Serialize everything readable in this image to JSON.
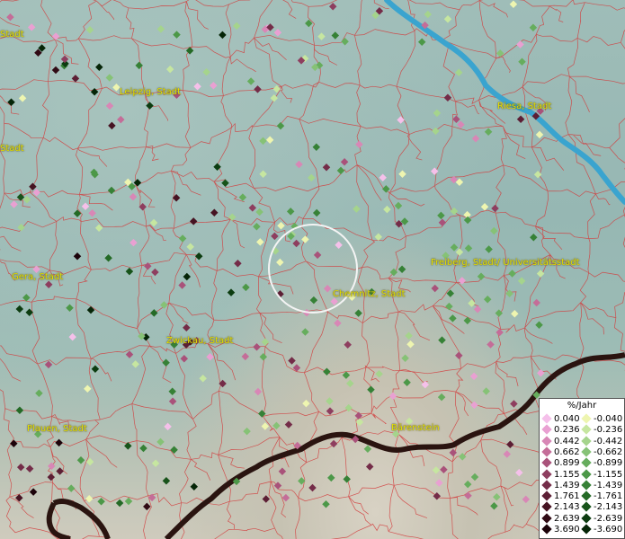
{
  "map": {
    "colors": {
      "boundary": "#d23c3c",
      "river": "#3aa4cf",
      "border": "#2a1410",
      "label": "#e6e000"
    },
    "cities": [
      {
        "name": "Stadt",
        "id": "city-stadt-top"
      },
      {
        "name": "Leipzig, Stadt",
        "id": "city-leipzig"
      },
      {
        "name": "Riesa, Stadt",
        "id": "city-riesa"
      },
      {
        "name": "Stadt",
        "id": "city-stadt-left"
      },
      {
        "name": "Gera, Stadt",
        "id": "city-gera"
      },
      {
        "name": "Freiberg, Stadt/ Universitätsstadt",
        "id": "city-freiberg"
      },
      {
        "name": "Chemnitz, Stadt",
        "id": "city-chemnitz"
      },
      {
        "name": "Zwickau, Stadt",
        "id": "city-zwickau"
      },
      {
        "name": "Plauen, Stadt",
        "id": "city-plauen"
      },
      {
        "name": "Bärenstein",
        "id": "city-baerenstein"
      }
    ]
  },
  "legend": {
    "title": "%/Jahr",
    "positive": [
      {
        "label": "0.040",
        "color": "#f5c0ea"
      },
      {
        "label": "0.236",
        "color": "#e9a0d2"
      },
      {
        "label": "0.442",
        "color": "#d887b6"
      },
      {
        "label": "0.662",
        "color": "#c46d98"
      },
      {
        "label": "0.899",
        "color": "#a9527a"
      },
      {
        "label": "1.155",
        "color": "#8e3e5f"
      },
      {
        "label": "1.439",
        "color": "#742c48"
      },
      {
        "label": "1.761",
        "color": "#5c1e34"
      },
      {
        "label": "2.143",
        "color": "#461322"
      },
      {
        "label": "2.639",
        "color": "#300a14"
      },
      {
        "label": "3.690",
        "color": "#1c030a"
      }
    ],
    "negative": [
      {
        "label": "-0.040",
        "color": "#eef5b0"
      },
      {
        "label": "-0.236",
        "color": "#c6e6a0"
      },
      {
        "label": "-0.442",
        "color": "#a5d48c"
      },
      {
        "label": "-0.662",
        "color": "#86c276"
      },
      {
        "label": "-0.899",
        "color": "#66ad5d"
      },
      {
        "label": "-1.155",
        "color": "#4c9848"
      },
      {
        "label": "-1.439",
        "color": "#368136"
      },
      {
        "label": "-1.761",
        "color": "#246a26"
      },
      {
        "label": "-2.143",
        "color": "#17531a"
      },
      {
        "label": "-2.639",
        "color": "#0c3c10"
      },
      {
        "label": "-3.690",
        "color": "#052507"
      }
    ]
  }
}
